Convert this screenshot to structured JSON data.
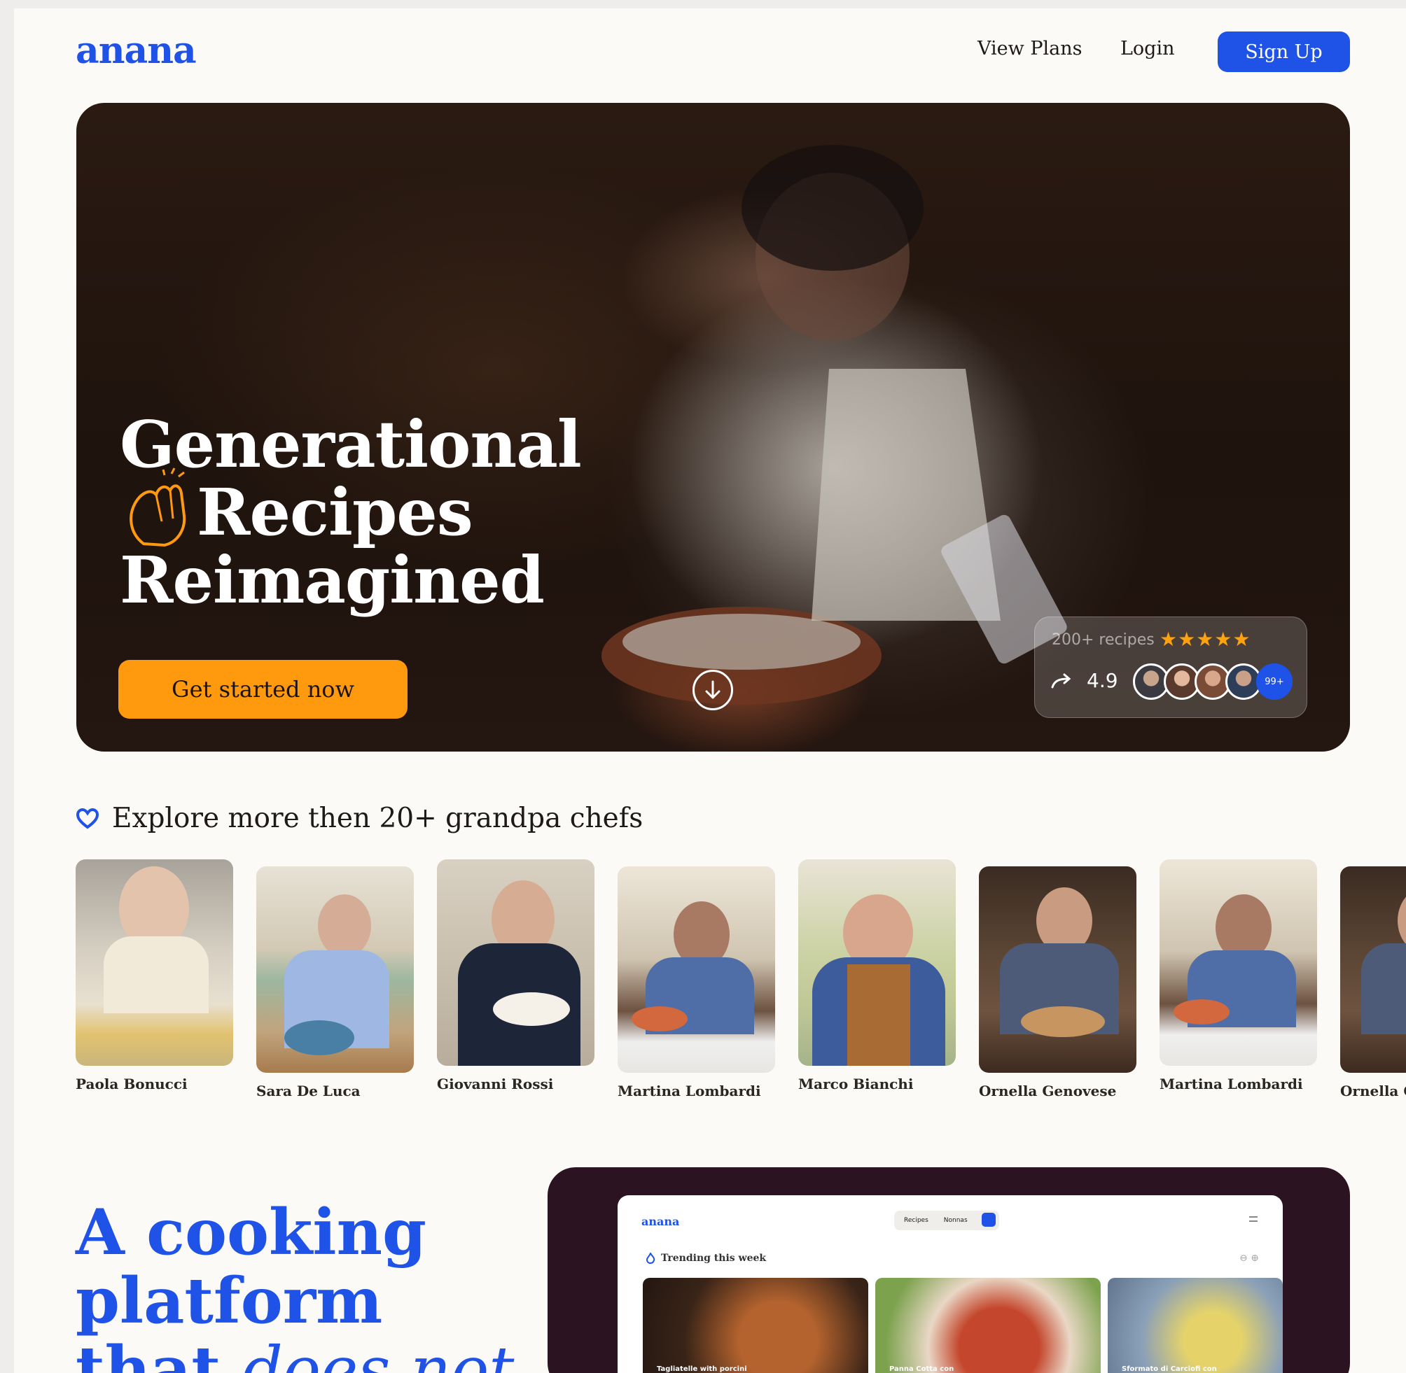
{
  "header": {
    "logo": "anana",
    "nav": {
      "view_plans": "View Plans",
      "login": "Login",
      "signup": "Sign Up"
    }
  },
  "hero": {
    "title_line1": "Generational",
    "title_line2": "Recipes",
    "title_line3": "Reimagined",
    "cta": "Get started now",
    "rating": {
      "recipes": "200+ recipes",
      "stars": "★★★★★",
      "score": "4.9",
      "more": "99+"
    }
  },
  "chefs": {
    "heading": "Explore more then 20+ grandpa chefs",
    "items": [
      {
        "name": "Paola Bonucci"
      },
      {
        "name": "Sara De Luca"
      },
      {
        "name": "Giovanni Rossi"
      },
      {
        "name": "Martina Lombardi"
      },
      {
        "name": "Marco Bianchi"
      },
      {
        "name": "Ornella Genovese"
      },
      {
        "name": "Martina Lombardi"
      },
      {
        "name": "Ornella G"
      }
    ]
  },
  "platform": {
    "title_line1": "A cooking",
    "title_line2": "platform",
    "title_line3_a": "that",
    "title_line3_b": "does not"
  },
  "demo": {
    "logo": "anana",
    "tab_recipes": "Recipes",
    "tab_nonnas": "Nonnas",
    "trending": "Trending this week",
    "arrows": "⊖ ⊕",
    "cards": [
      {
        "label": "Tagliatelle with porcini"
      },
      {
        "label": "Panna Cotta con"
      },
      {
        "label": "Sformato di Carciofi con"
      }
    ]
  },
  "colors": {
    "brand_blue": "#1f52e6",
    "accent_orange": "#ff9a0f",
    "demo_bg": "#2c1321"
  }
}
